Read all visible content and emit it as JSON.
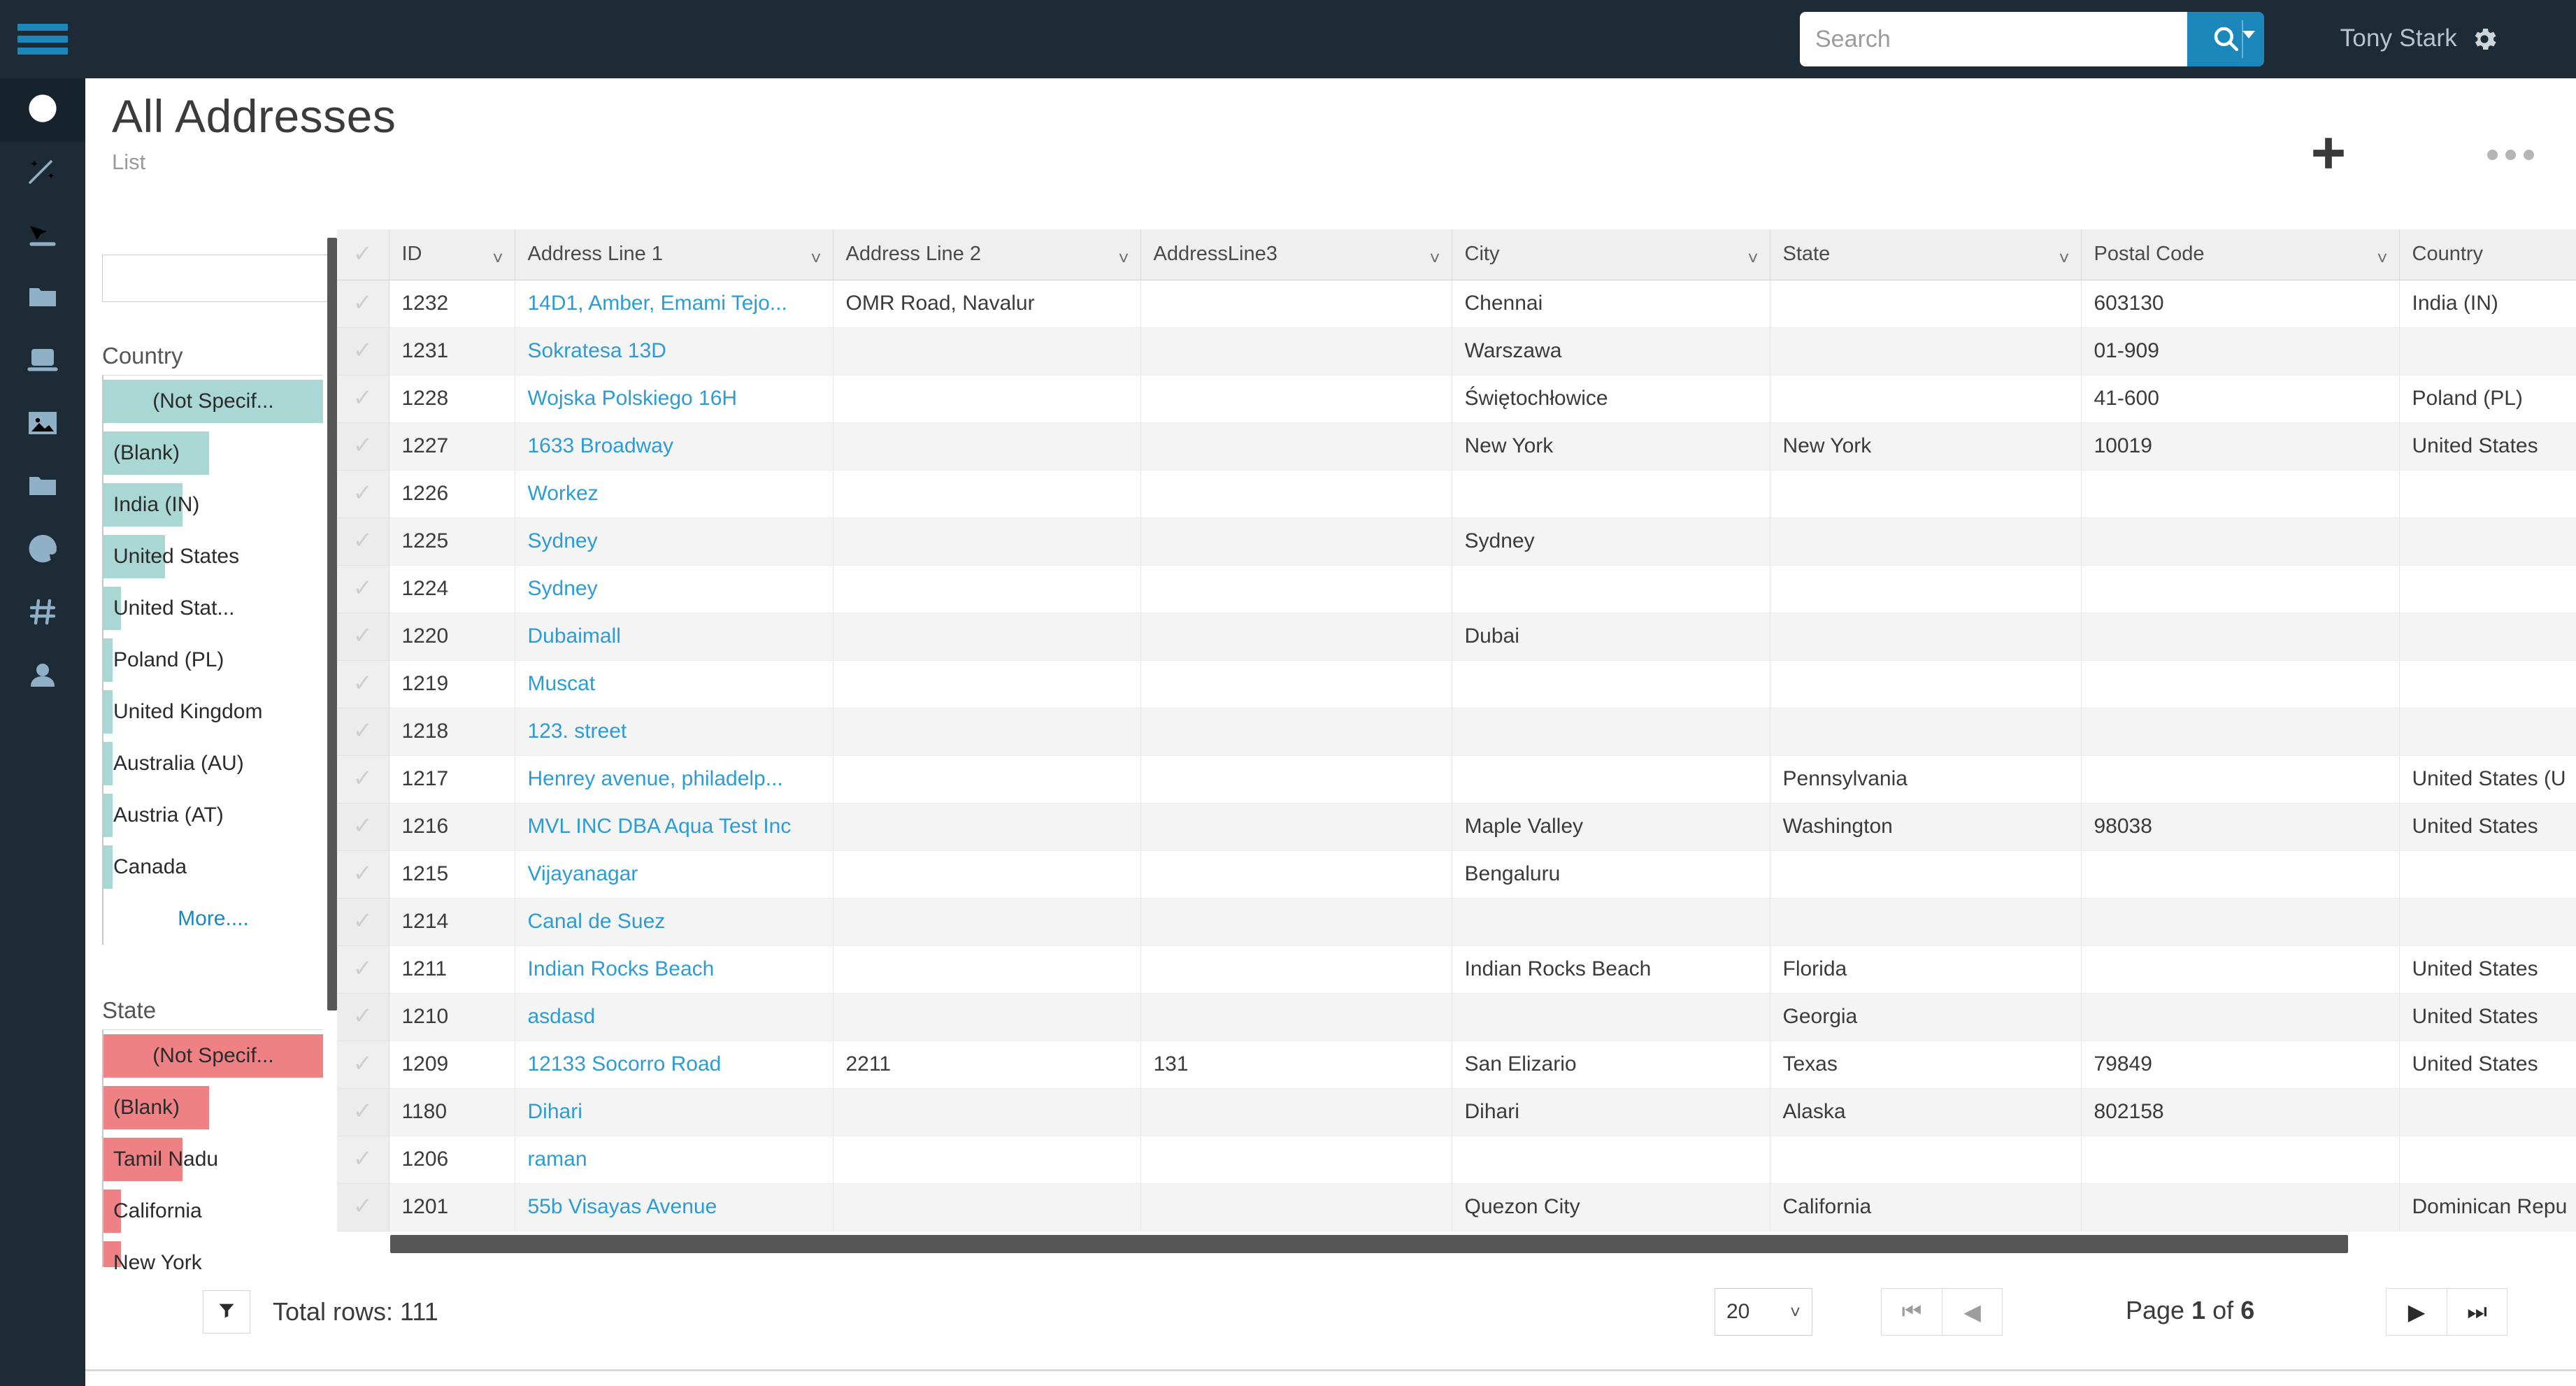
{
  "topbar": {
    "menu_icon": "hamburger-icon",
    "search": {
      "value": "",
      "placeholder": "Search",
      "button_icon": "search-icon",
      "dropdown_icon": "caret-down-icon"
    },
    "user_name": "Tony Stark",
    "settings_icon": "gear-icon"
  },
  "rail": {
    "items": [
      {
        "icon": "globe-icon",
        "active": true
      },
      {
        "icon": "magic-wand-icon",
        "active": false
      },
      {
        "icon": "pointer-icon",
        "active": false
      },
      {
        "icon": "folder-icon",
        "active": false
      },
      {
        "icon": "laptop-icon",
        "active": false
      },
      {
        "icon": "image-icon",
        "active": false
      },
      {
        "icon": "folder-icon",
        "active": false
      },
      {
        "icon": "at-sign-icon",
        "active": false
      },
      {
        "icon": "hash-icon",
        "active": false
      },
      {
        "icon": "user-icon",
        "active": false
      }
    ]
  },
  "facets": {
    "search": {
      "value": "",
      "placeholder": "",
      "button_icon": "search-icon"
    },
    "groups": [
      {
        "title": "Country",
        "color": "#a9d8d4",
        "items": [
          {
            "label": "(Not Specif...",
            "bar_pct": 100,
            "align": "right"
          },
          {
            "label": "(Blank)",
            "bar_pct": 48,
            "align": "left"
          },
          {
            "label": "India (IN)",
            "bar_pct": 36,
            "align": "left"
          },
          {
            "label": "United States",
            "bar_pct": 28,
            "align": "left"
          },
          {
            "label": "United Stat...",
            "bar_pct": 8,
            "align": "left"
          },
          {
            "label": "Poland (PL)",
            "bar_pct": 4,
            "align": "left"
          },
          {
            "label": "United Kingdom",
            "bar_pct": 4,
            "align": "left"
          },
          {
            "label": "Australia (AU)",
            "bar_pct": 4,
            "align": "left"
          },
          {
            "label": "Austria (AT)",
            "bar_pct": 4,
            "align": "left"
          },
          {
            "label": "Canada",
            "bar_pct": 4,
            "align": "left"
          }
        ],
        "more_label": "More...."
      },
      {
        "title": "State",
        "color": "#ef8084",
        "items": [
          {
            "label": "(Not Specif...",
            "bar_pct": 100,
            "align": "right"
          },
          {
            "label": "(Blank)",
            "bar_pct": 48,
            "align": "left"
          },
          {
            "label": "Tamil Nadu",
            "bar_pct": 36,
            "align": "left"
          },
          {
            "label": "California",
            "bar_pct": 8,
            "align": "left"
          },
          {
            "label": "New York",
            "bar_pct": 8,
            "align": "left"
          }
        ],
        "more_label": ""
      }
    ]
  },
  "page": {
    "title": "All Addresses",
    "subtitle": "List",
    "actions": [
      {
        "name": "add-button",
        "icon": "plus-icon"
      },
      {
        "name": "grid-view-button",
        "icon": "grid-icon"
      },
      {
        "name": "more-actions-button",
        "icon": "ellipsis-icon"
      }
    ]
  },
  "table": {
    "columns": [
      "ID",
      "Address Line 1",
      "Address Line 2",
      "AddressLine3",
      "City",
      "State",
      "Postal Code",
      "Country"
    ],
    "rows": [
      {
        "id": "1232",
        "line1": "14D1, Amber, Emami Tejo...",
        "line2": "OMR Road, Navalur",
        "line3": "",
        "city": "Chennai",
        "state": "",
        "postal": "603130",
        "country": "India (IN)"
      },
      {
        "id": "1231",
        "line1": "Sokratesa 13D",
        "line2": "",
        "line3": "",
        "city": "Warszawa",
        "state": "",
        "postal": "01-909",
        "country": ""
      },
      {
        "id": "1228",
        "line1": "Wojska Polskiego 16H",
        "line2": "",
        "line3": "",
        "city": "Świętochłowice",
        "state": "",
        "postal": "41-600",
        "country": "Poland (PL)"
      },
      {
        "id": "1227",
        "line1": "1633 Broadway",
        "line2": "",
        "line3": "",
        "city": "New York",
        "state": "New York",
        "postal": "10019",
        "country": "United States"
      },
      {
        "id": "1226",
        "line1": "Workez",
        "line2": "",
        "line3": "",
        "city": "",
        "state": "",
        "postal": "",
        "country": ""
      },
      {
        "id": "1225",
        "line1": "Sydney",
        "line2": "",
        "line3": "",
        "city": "Sydney",
        "state": "",
        "postal": "",
        "country": ""
      },
      {
        "id": "1224",
        "line1": "Sydney",
        "line2": "",
        "line3": "",
        "city": "",
        "state": "",
        "postal": "",
        "country": ""
      },
      {
        "id": "1220",
        "line1": "Dubaimall",
        "line2": "",
        "line3": "",
        "city": "Dubai",
        "state": "",
        "postal": "",
        "country": ""
      },
      {
        "id": "1219",
        "line1": "Muscat",
        "line2": "",
        "line3": "",
        "city": "",
        "state": "",
        "postal": "",
        "country": ""
      },
      {
        "id": "1218",
        "line1": "123. street",
        "line2": "",
        "line3": "",
        "city": "",
        "state": "",
        "postal": "",
        "country": ""
      },
      {
        "id": "1217",
        "line1": "Henrey avenue, philadelp...",
        "line2": "",
        "line3": "",
        "city": "",
        "state": "Pennsylvania",
        "postal": "",
        "country": "United States (U"
      },
      {
        "id": "1216",
        "line1": "MVL INC DBA Aqua Test Inc",
        "line2": "",
        "line3": "",
        "city": "Maple Valley",
        "state": "Washington",
        "postal": "98038",
        "country": "United States"
      },
      {
        "id": "1215",
        "line1": "Vijayanagar",
        "line2": "",
        "line3": "",
        "city": "Bengaluru",
        "state": "",
        "postal": "",
        "country": ""
      },
      {
        "id": "1214",
        "line1": "Canal de Suez",
        "line2": "",
        "line3": "",
        "city": "",
        "state": "",
        "postal": "",
        "country": ""
      },
      {
        "id": "1211",
        "line1": "Indian Rocks Beach",
        "line2": "",
        "line3": "",
        "city": "Indian Rocks Beach",
        "state": "Florida",
        "postal": "",
        "country": "United States"
      },
      {
        "id": "1210",
        "line1": "asdasd",
        "line2": "",
        "line3": "",
        "city": "",
        "state": "Georgia",
        "postal": "",
        "country": "United States"
      },
      {
        "id": "1209",
        "line1": "12133 Socorro Road",
        "line2": "2211",
        "line3": "131",
        "city": "San Elizario",
        "state": "Texas",
        "postal": "79849",
        "country": "United States"
      },
      {
        "id": "1180",
        "line1": "Dihari",
        "line2": "",
        "line3": "",
        "city": "Dihari",
        "state": "Alaska",
        "postal": "802158",
        "country": ""
      },
      {
        "id": "1206",
        "line1": "raman",
        "line2": "",
        "line3": "",
        "city": "",
        "state": "",
        "postal": "",
        "country": ""
      },
      {
        "id": "1201",
        "line1": "55b Visayas Avenue",
        "line2": "",
        "line3": "",
        "city": "Quezon City",
        "state": "California",
        "postal": "",
        "country": "Dominican Repu"
      }
    ]
  },
  "footer": {
    "filter_icon": "funnel-icon",
    "total_rows_label": "Total rows: 111",
    "page_size": "20",
    "page_size_caret": "chevron-down-icon",
    "first_icon": "first-page-icon",
    "prev_icon": "prev-page-icon",
    "next_icon": "next-page-icon",
    "last_icon": "last-page-icon",
    "page_prefix": "Page",
    "page_current": "1",
    "page_of": "of",
    "page_total": "6"
  },
  "colors": {
    "brand": "#1b87ba",
    "topbar": "#1d2b36",
    "link": "#2d9cd4",
    "country_bar": "#a9d8d4",
    "state_bar": "#ef8084"
  }
}
